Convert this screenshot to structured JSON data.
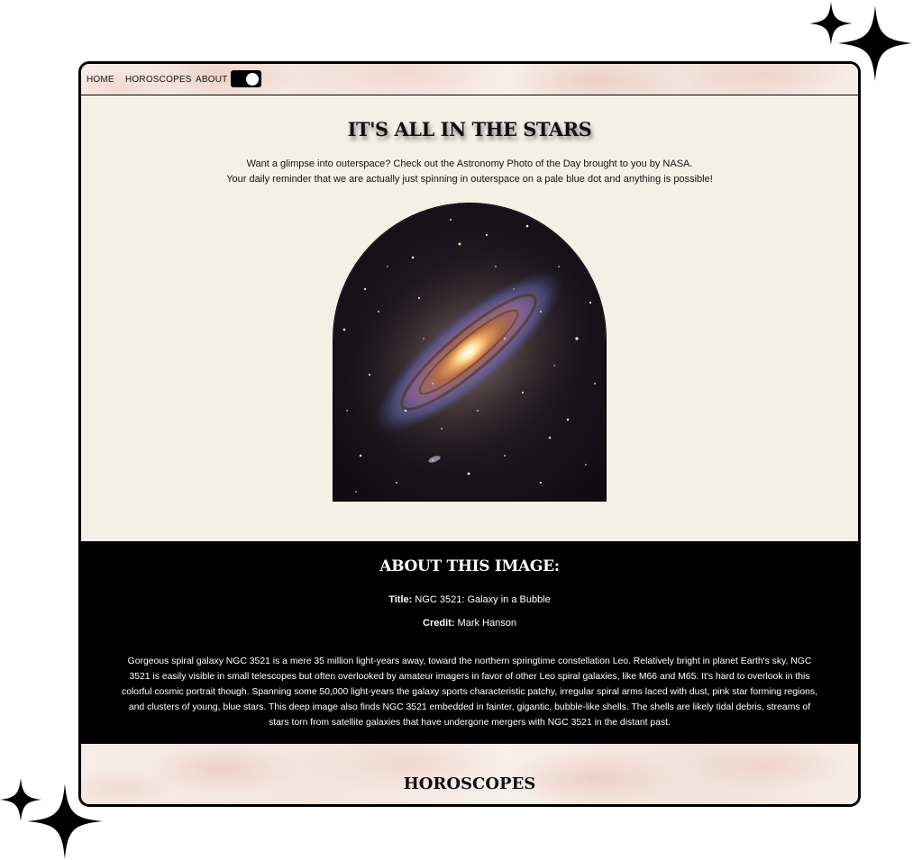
{
  "nav": {
    "home": "HOME",
    "horoscopes": "HOROSCOPES",
    "about": "ABOUT",
    "theme_toggle_state": "on"
  },
  "hero": {
    "title": "IT'S ALL IN THE STARS",
    "intro_line1": "Want a glimpse into outerspace? Check out the Astronomy Photo of the Day brought to you by NASA.",
    "intro_line2": "Your daily reminder that we are actually just spinning in outerspace on a pale blue dot and anything is possible!"
  },
  "apod": {
    "heading": "ABOUT THIS IMAGE:",
    "title_label": "Title:",
    "title_value": "NGC 3521: Galaxy in a Bubble",
    "credit_label": "Credit:",
    "credit_value": "Mark Hanson",
    "explanation": "Gorgeous spiral galaxy NGC 3521 is a mere 35 million light-years away, toward the northern springtime constellation Leo. Relatively bright in planet Earth's sky, NGC 3521 is easily visible in small telescopes but often overlooked by amateur imagers in favor of other Leo spiral galaxies, like M66 and M65. It's hard to overlook in this colorful cosmic portrait though. Spanning some 50,000 light-years the galaxy sports characteristic patchy, irregular spiral arms laced with dust, pink star forming regions, and clusters of young, blue stars. This deep image also finds NGC 3521 embedded in fainter, gigantic, bubble-like shells. The shells are likely tidal debris, streams of stars torn from satellite galaxies that have undergone mergers with NGC 3521 in the distant past."
  },
  "horoscopes": {
    "heading": "HOROSCOPES"
  },
  "colors": {
    "frame_border": "#000000",
    "hero_background": "#f3f1e6",
    "about_background": "#000000",
    "header_watercolor": "#f3e4de"
  },
  "icons": [
    "sparkle-icon",
    "toggle-switch",
    "galaxy-photo"
  ]
}
